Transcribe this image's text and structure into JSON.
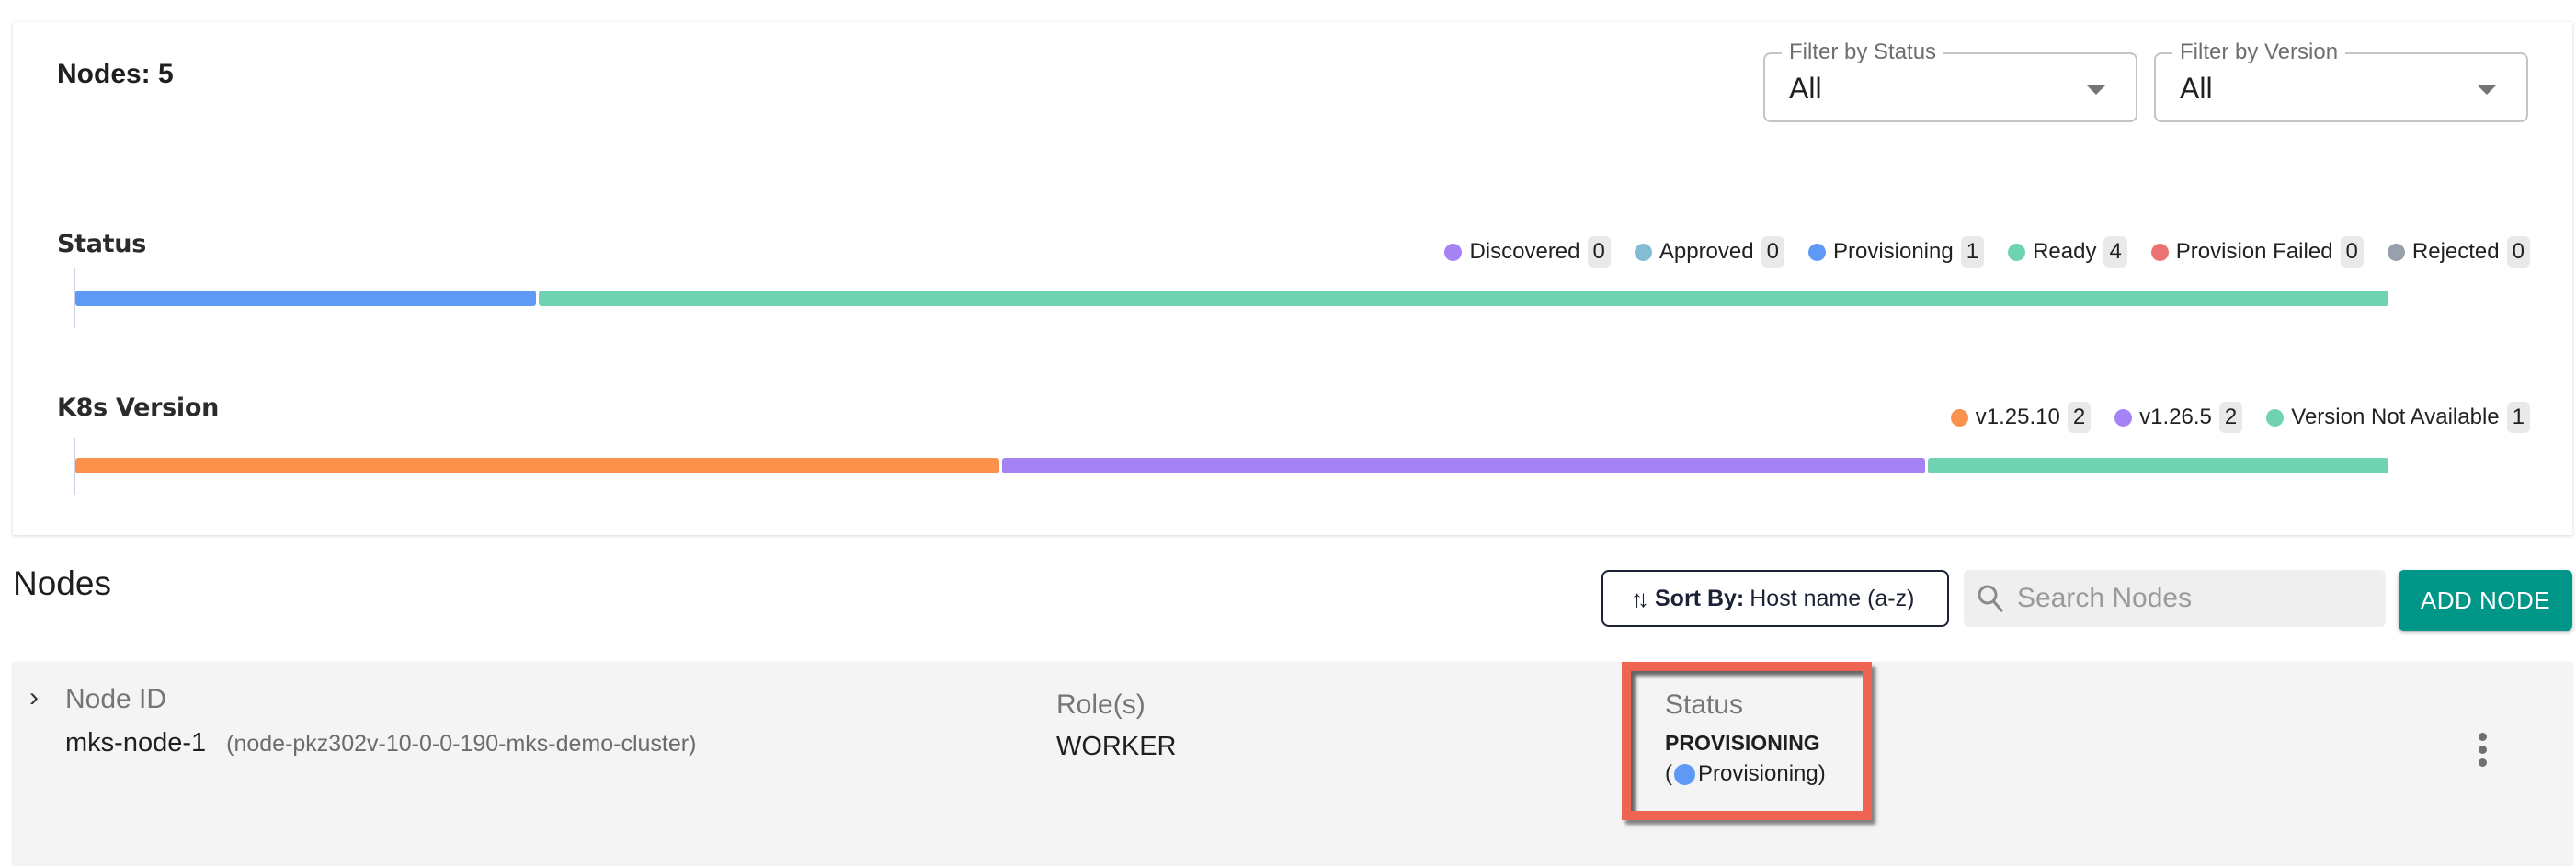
{
  "summary": {
    "nodes_count_label": "Nodes: 5",
    "filters": [
      {
        "label": "Filter by Status",
        "value": "All"
      },
      {
        "label": "Filter by Version",
        "value": "All"
      }
    ]
  },
  "chart_data": [
    {
      "type": "bar",
      "orientation": "horizontal-stacked",
      "title": "Status",
      "total": 5,
      "categories": [
        "Discovered",
        "Approved",
        "Provisioning",
        "Ready",
        "Provision Failed",
        "Rejected"
      ],
      "values": [
        0,
        0,
        1,
        4,
        0,
        0
      ],
      "colors": [
        "#a583f5",
        "#84bcd3",
        "#5e9af5",
        "#6fd3b1",
        "#ea7474",
        "#9aa0ab"
      ],
      "legend": "top-right"
    },
    {
      "type": "bar",
      "orientation": "horizontal-stacked",
      "title": "K8s Version",
      "total": 5,
      "categories": [
        "v1.25.10",
        "v1.26.5",
        "Version Not Available"
      ],
      "values": [
        2,
        2,
        1
      ],
      "colors": [
        "#fb914b",
        "#a583f5",
        "#6fd3b1"
      ],
      "legend": "top-right"
    }
  ],
  "nodes_section": {
    "title": "Nodes",
    "sort": {
      "prefix": "Sort By:",
      "value": "Host name (a-z)"
    },
    "search_placeholder": "Search Nodes",
    "search_value": "",
    "add_button": "ADD NODE",
    "rows": [
      {
        "node_id_label": "Node ID",
        "node_name": "mks-node-1",
        "node_hostname": "(node-pkz302v-10-0-0-190-mks-demo-cluster)",
        "roles_label": "Role(s)",
        "roles": "WORKER",
        "status_label": "Status",
        "status": "PROVISIONING",
        "status_detail": "Provisioning",
        "status_color": "#5e9af5"
      }
    ]
  },
  "highlight_color": "#ef6351"
}
